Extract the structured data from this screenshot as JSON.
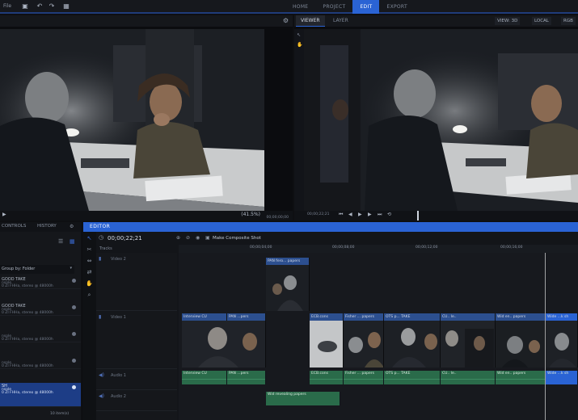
{
  "topbar": {
    "menu_file": "File",
    "tabs": [
      "HOME",
      "PROJECT",
      "EDIT",
      "EXPORT"
    ],
    "active_tab": "EDIT"
  },
  "source": {
    "zoom": "(41.5%)",
    "timecode": "00;00;00;00"
  },
  "program": {
    "tabs": [
      "VIEWER",
      "LAYER"
    ],
    "view_label": "VIEW: 3D",
    "local_label": "LOCAL",
    "color_space": "RGB",
    "timecode": "00;00;22;21"
  },
  "left_panel": {
    "tabs": [
      "CONTROLS",
      "HISTORY"
    ],
    "group_by": "Group by: Folder",
    "bins": [
      {
        "title": "GOOD TAKE",
        "line1": "nsole",
        "line2": "0 ZI FHHa, stereo @ 48000h"
      },
      {
        "title": "GOOD TAKE",
        "line1": "nsole",
        "line2": "0 ZI FHHa, stereo @ 48000h"
      },
      {
        "title": "",
        "line1": "nsole",
        "line2": "0 ZI FHHa, stereo @ 48000h"
      },
      {
        "title": "",
        "line1": "nsole",
        "line2": "0 ZI FHHa, stereo @ 48000h"
      },
      {
        "title": "SH",
        "line1": "nsole",
        "line2": "0 ZI FHHa, stereo @ 48000h"
      }
    ],
    "footer": "10 item(s)"
  },
  "editor": {
    "tab": "EDITOR",
    "timecode": "00;00;22;21",
    "composite_label": "Make Composite Shot",
    "tracks_label": "Tracks",
    "ruler_labels": [
      "00;00;04;00",
      "00;00;08;00",
      "00;00;12;00",
      "00;00;16;00"
    ],
    "track_names": [
      "Video 2",
      "Video 1",
      "Audio 1",
      "Audio 2"
    ],
    "video2_clip": "PAN fero... papers",
    "video1_clips": [
      "Interview CU",
      "PAN ...pers",
      "ECB.cons",
      "Fisher ... papers",
      "OTS p... TAKE",
      "CU.. le..",
      "Wid en.. papers",
      "Wide ...k sh"
    ],
    "audio1_clips": [
      "Interview CU",
      "PAN ...pers",
      "ECB.cons",
      "Fisher ... papers",
      "OTS p... TAKE",
      "CU.. le..",
      "Wid en.. papers",
      "Wide ...k sh"
    ],
    "audio2_clip": "Wid revealing papers"
  },
  "colors": {
    "accent": "#2a63d4",
    "audio_clip": "#2a6b4a",
    "video_clip_header": "#2c4f8f"
  }
}
